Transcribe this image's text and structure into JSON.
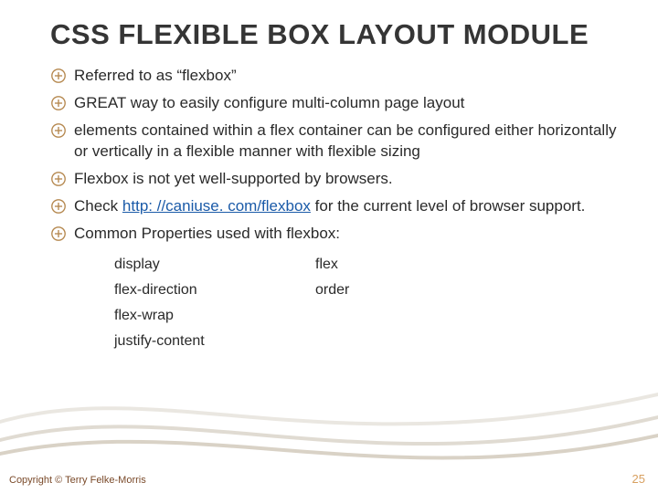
{
  "title": "CSS FLEXIBLE BOX LAYOUT MODULE",
  "bullets": [
    {
      "text": "Referred to as “flexbox”"
    },
    {
      "text": "GREAT way to easily configure multi-column page layout"
    },
    {
      "text": "elements contained within a flex container can be configured either horizontally or vertically in a flexible manner with flexible sizing"
    },
    {
      "text": "Flexbox is not yet well-supported by browsers."
    },
    {
      "prefix": "Check ",
      "link_text": "http: //caniuse. com/flexbox",
      "link_href": "http://caniuse.com/flexbox",
      "suffix": " for the current level of browser support."
    },
    {
      "text": "Common Properties used with flexbox:"
    }
  ],
  "props_col1": [
    "display",
    "flex-direction",
    "flex-wrap",
    "justify-content"
  ],
  "props_col2": [
    "flex",
    "order"
  ],
  "copyright": "Copyright © Terry Felke-Morris",
  "page_number": "25",
  "colors": {
    "accent": "#b5884f",
    "link": "#1a5aa8"
  }
}
